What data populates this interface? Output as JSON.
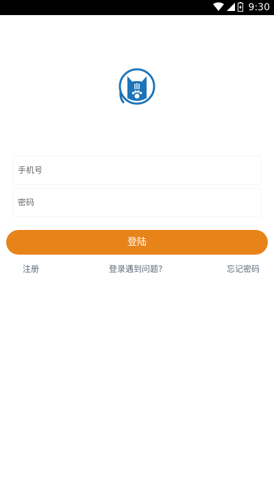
{
  "status_bar": {
    "time": "9:30"
  },
  "form": {
    "phone_placeholder": "手机号",
    "password_placeholder": "密码"
  },
  "buttons": {
    "login_label": "登陆"
  },
  "links": {
    "register": "注册",
    "login_problem": "登录遇到问题?",
    "forgot_password": "忘记密码"
  },
  "colors": {
    "accent": "#E8831A",
    "logo": "#1E74B8",
    "link": "#5C6B7A"
  },
  "icons": {
    "logo": "cat-logo-icon",
    "wifi": "wifi-icon",
    "signal": "signal-icon",
    "battery": "battery-icon"
  }
}
